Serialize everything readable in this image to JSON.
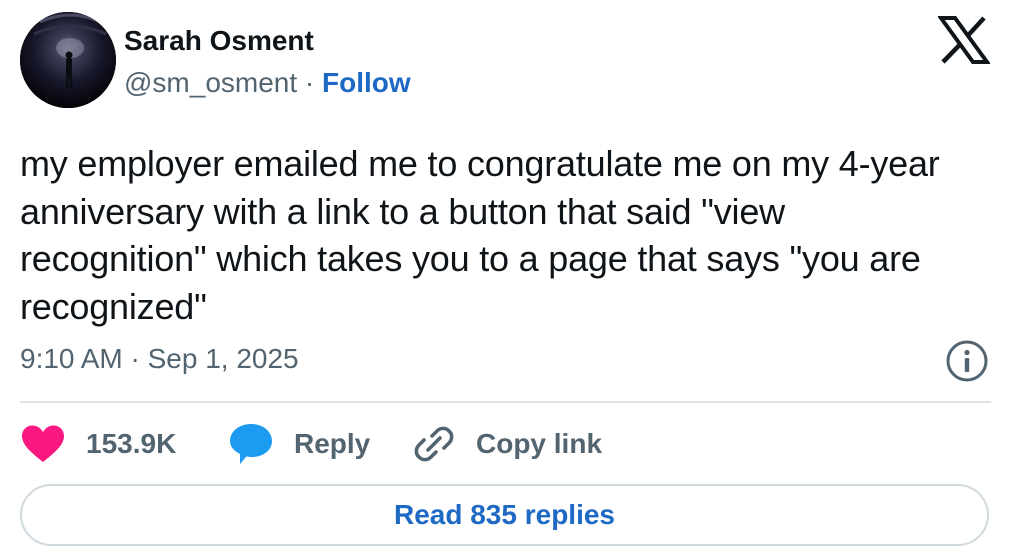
{
  "author": {
    "display_name": "Sarah Osment",
    "handle": "@sm_osment",
    "separator": "·",
    "follow_label": "Follow",
    "avatar_icon": "tunnel-photo-avatar"
  },
  "brand": {
    "icon": "x-logo-icon"
  },
  "tweet": {
    "text": "my employer emailed me to congratulate me on my 4-year anniversary with a link to a button that said \"view recognition\" which takes you to a page that says \"you are recognized\"",
    "timestamp": "9:10 AM · Sep 1, 2025"
  },
  "actions": {
    "like_count": "153.9K",
    "reply_label": "Reply",
    "copy_link_label": "Copy link"
  },
  "footer": {
    "read_replies_label": "Read 835 replies"
  },
  "colors": {
    "like": "#f91880",
    "reply": "#1d9bf0",
    "link": "#1d69c4",
    "muted": "#536471",
    "text": "#0f1419",
    "border": "#cfd9de"
  }
}
